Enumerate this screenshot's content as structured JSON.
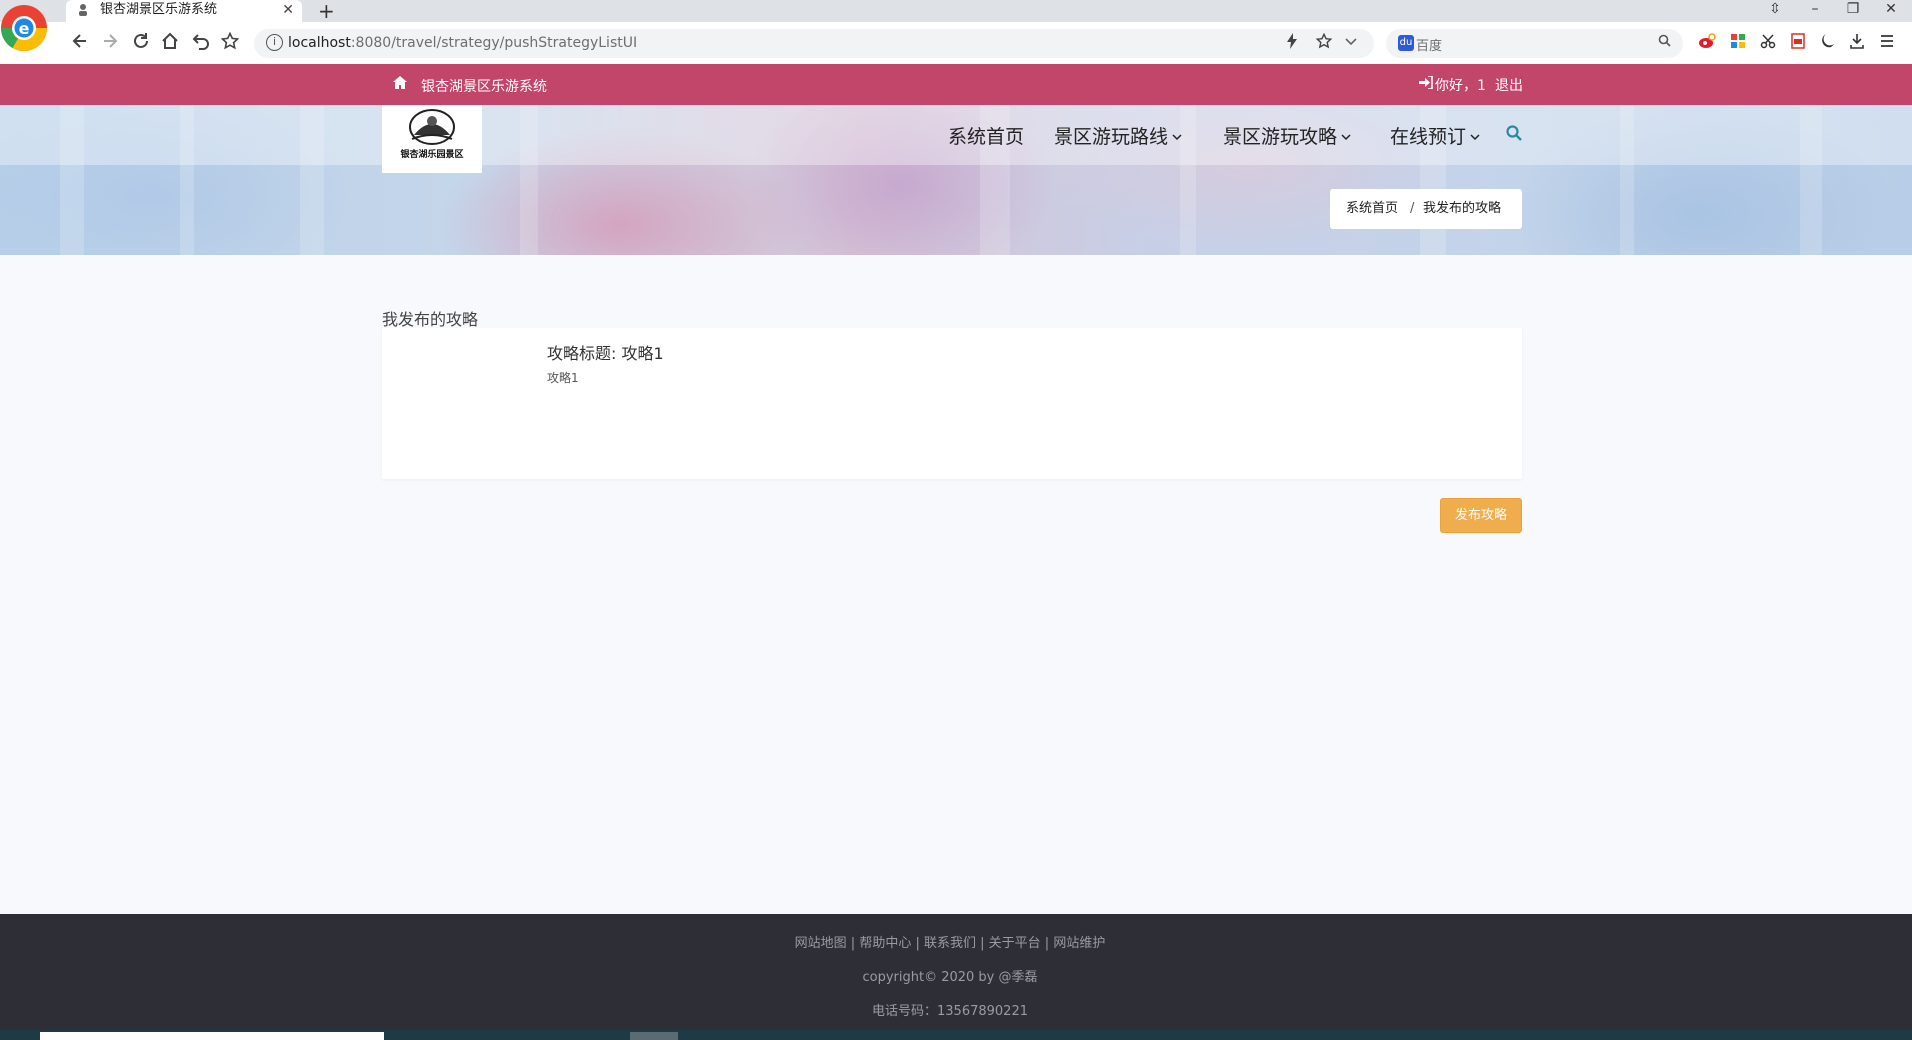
{
  "browser": {
    "tab_title": "银杏湖景区乐游系统",
    "tab_close": "✕",
    "new_tab": "+",
    "url_host": "localhost",
    "url_rest": ":8080/travel/strategy/pushStrategyListUI",
    "search_placeholder": "百度",
    "window_controls": [
      "⇳",
      "–",
      "❐",
      "✕"
    ],
    "extensions": [
      "weibo-icon",
      "apps-icon",
      "scissors-icon",
      "pdf-icon",
      "moon-icon",
      "download-icon",
      "menu-icon"
    ]
  },
  "topbar": {
    "site_name": "银杏湖景区乐游系统",
    "greeting": "你好，1",
    "logout": "退出"
  },
  "nav": {
    "home": "系统首页",
    "routes": "景区游玩路线",
    "strategy": "景区游玩攻略",
    "booking": "在线预订",
    "chevron": "⌄"
  },
  "logo": {
    "text": "银杏湖乐园景区"
  },
  "breadcrumb": {
    "home": "系统首页",
    "separator": "/",
    "current": "我发布的攻略"
  },
  "main": {
    "section_title": "我发布的攻略",
    "strategies": [
      {
        "title": "攻略标题: 攻略1",
        "description": "攻略1"
      }
    ],
    "publish_button": "发布攻略"
  },
  "footer": {
    "links": [
      "网站地图",
      "帮助中心",
      "联系我们",
      "关于平台",
      "网站维护"
    ],
    "link_separator": " | ",
    "copyright": "copyright© 2020 by @季磊",
    "phone": "电话号码：13567890221"
  },
  "colors": {
    "topbar": "#c2456a",
    "publish_button": "#f0ad4e",
    "footer": "#2e2f36",
    "search_icon": "#2a8aa0"
  }
}
